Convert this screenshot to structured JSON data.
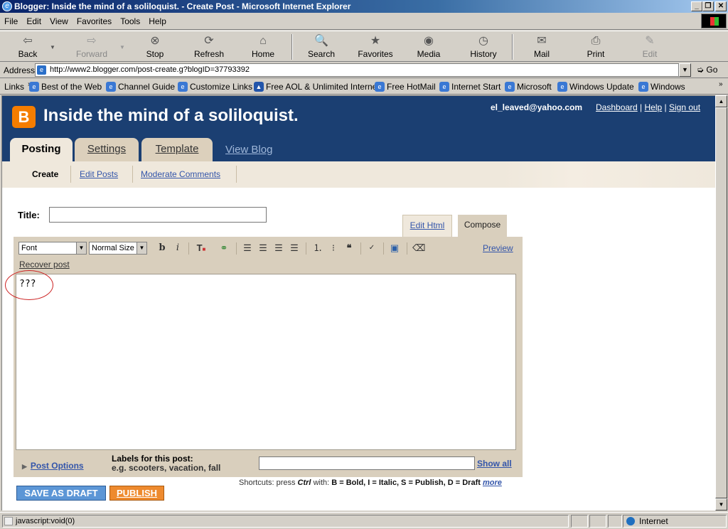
{
  "window": {
    "title": "Blogger: Inside the mind of a soliloquist. - Create Post - Microsoft Internet Explorer"
  },
  "menu": [
    "File",
    "Edit",
    "View",
    "Favorites",
    "Tools",
    "Help"
  ],
  "toolbar": {
    "back": "Back",
    "forward": "Forward",
    "stop": "Stop",
    "refresh": "Refresh",
    "home": "Home",
    "search": "Search",
    "favorites": "Favorites",
    "media": "Media",
    "history": "History",
    "mail": "Mail",
    "print": "Print",
    "edit": "Edit"
  },
  "address": {
    "label": "Address",
    "url": "http://www2.blogger.com/post-create.g?blogID=37793392",
    "go": "Go"
  },
  "links": {
    "label": "Links",
    "items": [
      "Best of the Web",
      "Channel Guide",
      "Customize Links",
      "Free AOL & Unlimited Internet",
      "Free HotMail",
      "Internet Start",
      "Microsoft",
      "Windows Update",
      "Windows"
    ]
  },
  "blog": {
    "title": "Inside the mind of a soliloquist.",
    "user": "el_leaved@yahoo.com",
    "nav": {
      "dashboard": "Dashboard",
      "help": "Help",
      "signout": "Sign out"
    },
    "tabs": {
      "posting": "Posting",
      "settings": "Settings",
      "template": "Template",
      "viewblog": "View Blog"
    },
    "subnav": {
      "create": "Create",
      "edit": "Edit Posts",
      "moderate": "Moderate Comments"
    }
  },
  "form": {
    "title_label": "Title:",
    "title_value": "",
    "edit_html": "Edit Html",
    "compose": "Compose",
    "font": "Font",
    "size": "Normal Size",
    "preview": "Preview",
    "recover": "Recover post",
    "body": "???",
    "post_options": "Post Options",
    "labels_heading": "Labels for this post:",
    "labels_eg": "e.g. scooters, vacation, fall",
    "show_all": "Show all",
    "shortcuts_prefix": "Shortcuts: press",
    "shortcuts_ctrl": "Ctrl",
    "shortcuts_with": "with:",
    "shortcuts_keys": "B = Bold, I = Italic, S = Publish, D = Draft",
    "shortcuts_more": "more",
    "save_draft": "SAVE AS DRAFT",
    "publish": "PUBLISH"
  },
  "status": {
    "text": "javascript:void(0)",
    "zone": "Internet"
  }
}
